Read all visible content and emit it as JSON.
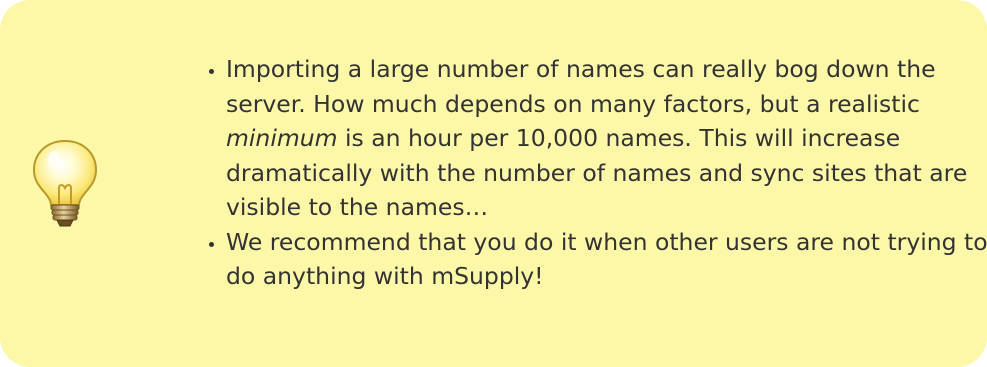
{
  "note": {
    "icon": "lightbulb-icon",
    "background_color": "#fdf7a8",
    "items": [
      {
        "text_before": "Importing a large number of names can really bog down the server. How much depends on many factors, but a realistic ",
        "emphasis": "minimum",
        "text_after": " is an hour per 10,000 names. This will increase dramatically with the number of names and sync sites that are visible to the names…"
      },
      {
        "text": "We recommend that you do it when other users are not trying to do anything with mSupply!"
      }
    ]
  }
}
